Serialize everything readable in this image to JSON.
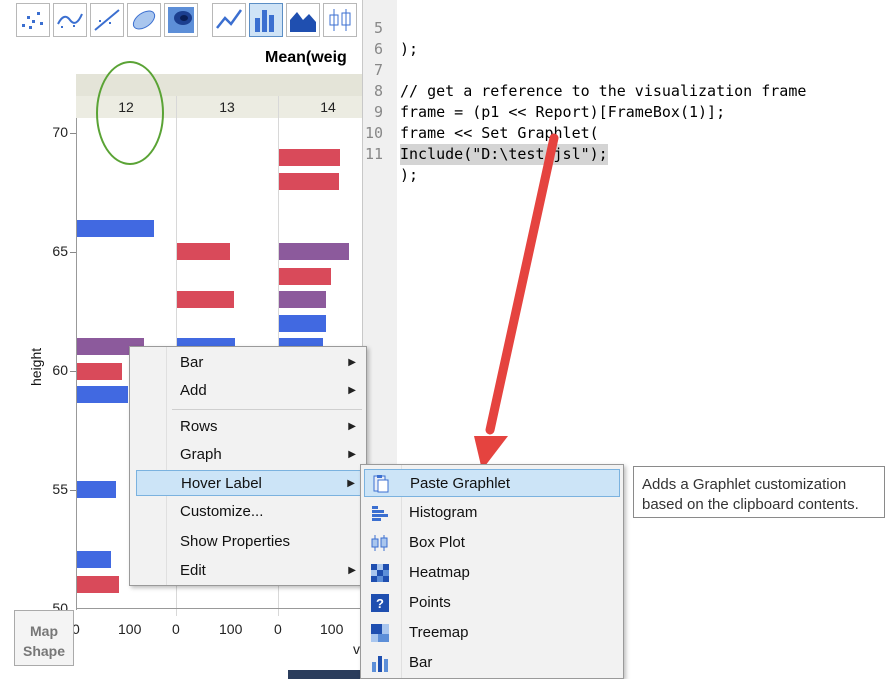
{
  "graph": {
    "title": "Mean(weig",
    "columns": [
      "12",
      "13",
      "14"
    ],
    "y_axis": {
      "title": "height",
      "ticks": [
        "70",
        "65",
        "60",
        "55",
        "50"
      ]
    },
    "x_axis": {
      "title": "v",
      "ticks": [
        "0",
        "100",
        "0",
        "100",
        "0",
        "100"
      ]
    },
    "map_shape": {
      "line1": "Map",
      "line2": "Shape"
    },
    "toolbar": [
      "points-icon",
      "smoother-icon",
      "line-of-fit-icon",
      "ellipse-icon",
      "contour-icon",
      "line-icon",
      "bar-icon",
      "area-icon",
      "box-plot-icon"
    ],
    "colors": {
      "blue": "#4169e1",
      "red": "#d94a5a",
      "purple": "#8c5a9c",
      "circle": "#5aa335",
      "arrow": "#e5433f"
    }
  },
  "editor": {
    "lines": [
      {
        "n": "5",
        "text": ");"
      },
      {
        "n": "6",
        "text": ""
      },
      {
        "n": "7",
        "text": "// get a reference to the visualization frame"
      },
      {
        "n": "8",
        "text": "frame = (p1 << Report)[FrameBox(1)];"
      },
      {
        "n": "9",
        "text": "frame << Set Graphlet("
      },
      {
        "n": "10",
        "text": "Include(\"D:\\test.jsl\");"
      },
      {
        "n": "11",
        "text": ");"
      }
    ]
  },
  "context_menu": {
    "items": [
      {
        "label": "Bar",
        "submenu": true
      },
      {
        "label": "Add",
        "submenu": true
      },
      {
        "label": "Rows",
        "submenu": true
      },
      {
        "label": "Graph",
        "submenu": true
      },
      {
        "label": "Hover Label",
        "submenu": true,
        "active": true
      },
      {
        "label": "Customize...",
        "submenu": false
      },
      {
        "label": "Show Properties",
        "submenu": false
      },
      {
        "label": "Edit",
        "submenu": true
      }
    ]
  },
  "submenu": {
    "items": [
      {
        "label": "Paste Graphlet",
        "icon": "paste-graphlet-icon"
      },
      {
        "label": "Histogram",
        "icon": "histogram-icon"
      },
      {
        "label": "Box Plot",
        "icon": "box-plot-icon"
      },
      {
        "label": "Heatmap",
        "icon": "heatmap-icon"
      },
      {
        "label": "Points",
        "icon": "points-icon"
      },
      {
        "label": "Treemap",
        "icon": "treemap-icon"
      },
      {
        "label": "Bar",
        "icon": "bar-icon"
      }
    ]
  },
  "tooltip": {
    "line1": "Adds a Graphlet customization",
    "line2": "based on the clipboard contents."
  }
}
